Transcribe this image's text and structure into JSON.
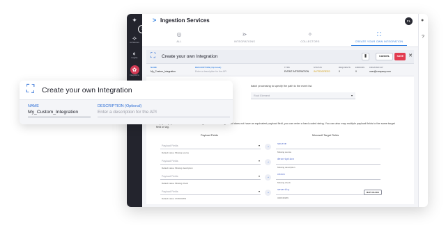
{
  "app": {
    "title": "Ingestion Services",
    "user_initials": "FL"
  },
  "leftbar": {
    "items": [
      {
        "icon": "network-icon",
        "label": "Architecture"
      },
      {
        "icon": "moon-icon",
        "label": "Insights"
      },
      {
        "icon": "integrations-icon",
        "label": "Integrations"
      }
    ]
  },
  "tabs": [
    {
      "label": "ALL",
      "icon": "all-icon"
    },
    {
      "label": "INTEGRATIONS",
      "icon": "integrations-icon"
    },
    {
      "label": "COLLECTORS",
      "icon": "collectors-icon"
    },
    {
      "label": "CREATE YOUR OWN INTEGRATION",
      "icon": "create-integration-icon",
      "active": true
    }
  ],
  "panel": {
    "title": "Create your own Integration",
    "cancel_label": "CANCEL",
    "save_label": "SAVE",
    "meta": {
      "name_label": "NAME",
      "name_value": "My_Custom_Integration",
      "desc_label": "DESCRIPTION (Optional)",
      "desc_placeholder": "Enter a description for the API",
      "type_label": "TYPE",
      "type_value": "EVENT INTEGRATION",
      "status_label": "STATUS",
      "status_value": "IN PROGRESS",
      "requests_label": "REQUESTS",
      "requests_value": "0",
      "errors_label": "ERRORS",
      "errors_value": "0",
      "created_by_label": "CREATED BY",
      "created_by_value": "user@company.com"
    },
    "batch_text": "batch processing to specify the path to the event list.",
    "root_element_placeholder": "Root Element",
    "mapping_text": "Map your payload fields to Microsoft target fields. If the target field does not have an equivalent payload field, you can enter a hard-coded string. You can also map multiple payload fields to the same target field or tag.",
    "payload_header": "Payload Fields",
    "target_header": "Microsoft Target Fields",
    "rows": [
      {
        "payload_placeholder": "Payload Fields",
        "default": "Default value: Missing source",
        "target": "source",
        "missing": "Missing source"
      },
      {
        "payload_placeholder": "Payload Fields",
        "default": "Default value: Missing description",
        "target": "description",
        "missing": "Missing description"
      },
      {
        "payload_placeholder": "Payload Fields",
        "default": "Default value: Missing check",
        "target": "check",
        "missing": "Missing check"
      },
      {
        "payload_placeholder": "Payload Fields",
        "default": "Default value: UNKNOWN",
        "target": "severity",
        "missing": "UNKNOWN",
        "badge": "MAP VALUES"
      }
    ]
  },
  "callout": {
    "title": "Create your own Integration",
    "name_label": "NAME",
    "name_value": "My_Custom_Integration",
    "desc_label": "DESCRIPTION (Optional)",
    "desc_placeholder": "Enter a description for the API"
  }
}
